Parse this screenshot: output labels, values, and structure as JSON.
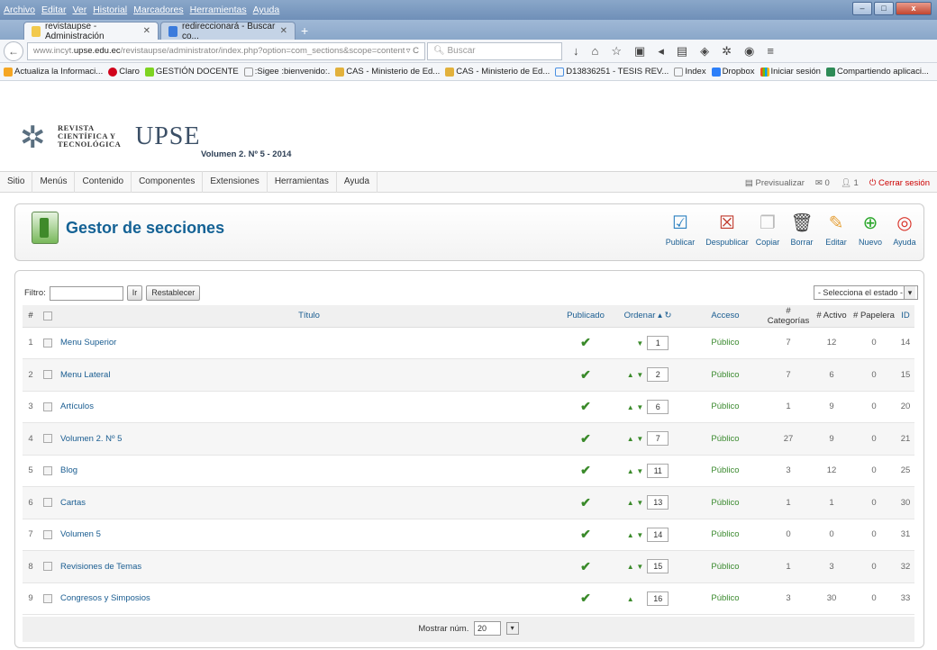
{
  "browser": {
    "menu": [
      "Archivo",
      "Editar",
      "Ver",
      "Historial",
      "Marcadores",
      "Herramientas",
      "Ayuda"
    ],
    "tabs": [
      {
        "label": "revistaupse - Administración",
        "active": true
      },
      {
        "label": "redireccionará - Buscar co...",
        "active": false
      }
    ],
    "url_prefix": "www.incyt.",
    "url_domain": "upse.edu.ec",
    "url_path": "/revistaupse/administrator/index.php?option=com_sections&scope=content",
    "search_placeholder": "Buscar",
    "bookmarks": [
      "Actualiza la Informaci...",
      "Claro",
      "GESTIÓN DOCENTE",
      ":Sigee :bienvenido:.",
      "CAS - Ministerio de Ed...",
      "CAS - Ministerio de Ed...",
      "D13836251 - TESIS REV...",
      "Index",
      "Dropbox",
      "Iniciar sesión",
      "Compartiendo aplicaci..."
    ]
  },
  "header": {
    "logo_line1": "REVISTA",
    "logo_line2": "CIENTÍFICA Y",
    "logo_line3": "TECNOLÓGICA",
    "logo_brand": "UPSE",
    "subtitle": "Volumen 2. Nº 5 - 2014"
  },
  "admin_menu": {
    "items": [
      "Sitio",
      "Menús",
      "Contenido",
      "Componentes",
      "Extensiones",
      "Herramientas",
      "Ayuda"
    ],
    "preview": "Previsualizar",
    "messages": "0",
    "users": "1",
    "logout": "Cerrar sesión"
  },
  "toolbar": {
    "title": "Gestor de secciones",
    "buttons": [
      "Publicar",
      "Despublicar",
      "Copiar",
      "Borrar",
      "Editar",
      "Nuevo",
      "Ayuda"
    ]
  },
  "filter": {
    "label": "Filtro:",
    "go_label": "Ir",
    "reset_label": "Restablecer",
    "state_select": "- Selecciona el estado -"
  },
  "table": {
    "headers": [
      "#",
      "Título",
      "Publicado",
      "Ordenar",
      "Acceso",
      "# Categorías",
      "# Activo",
      "# Papelera",
      "ID"
    ],
    "rows": [
      {
        "num": "1",
        "title": "Menu Superior",
        "order": "1",
        "access": "Público",
        "cats": "7",
        "active": "12",
        "trash": "0",
        "id": "14",
        "up": false,
        "down": true
      },
      {
        "num": "2",
        "title": "Menu Lateral",
        "order": "2",
        "access": "Público",
        "cats": "7",
        "active": "6",
        "trash": "0",
        "id": "15",
        "up": true,
        "down": true
      },
      {
        "num": "3",
        "title": "Artículos",
        "order": "6",
        "access": "Público",
        "cats": "1",
        "active": "9",
        "trash": "0",
        "id": "20",
        "up": true,
        "down": true
      },
      {
        "num": "4",
        "title": "Volumen 2. Nº 5",
        "order": "7",
        "access": "Público",
        "cats": "27",
        "active": "9",
        "trash": "0",
        "id": "21",
        "up": true,
        "down": true
      },
      {
        "num": "5",
        "title": "Blog",
        "order": "11",
        "access": "Público",
        "cats": "3",
        "active": "12",
        "trash": "0",
        "id": "25",
        "up": true,
        "down": true
      },
      {
        "num": "6",
        "title": "Cartas",
        "order": "13",
        "access": "Público",
        "cats": "1",
        "active": "1",
        "trash": "0",
        "id": "30",
        "up": true,
        "down": true
      },
      {
        "num": "7",
        "title": "Volumen 5",
        "order": "14",
        "access": "Público",
        "cats": "0",
        "active": "0",
        "trash": "0",
        "id": "31",
        "up": true,
        "down": true
      },
      {
        "num": "8",
        "title": "Revisiones de Temas",
        "order": "15",
        "access": "Público",
        "cats": "1",
        "active": "3",
        "trash": "0",
        "id": "32",
        "up": true,
        "down": true
      },
      {
        "num": "9",
        "title": "Congresos y Simposios",
        "order": "16",
        "access": "Público",
        "cats": "3",
        "active": "30",
        "trash": "0",
        "id": "33",
        "up": true,
        "down": false
      }
    ]
  },
  "footer": {
    "show_label": "Mostrar núm.",
    "show_value": "20"
  },
  "colors": {
    "title_blue": "#146295",
    "link_blue": "#1a5d91",
    "published_green": "#3a8a2a"
  }
}
